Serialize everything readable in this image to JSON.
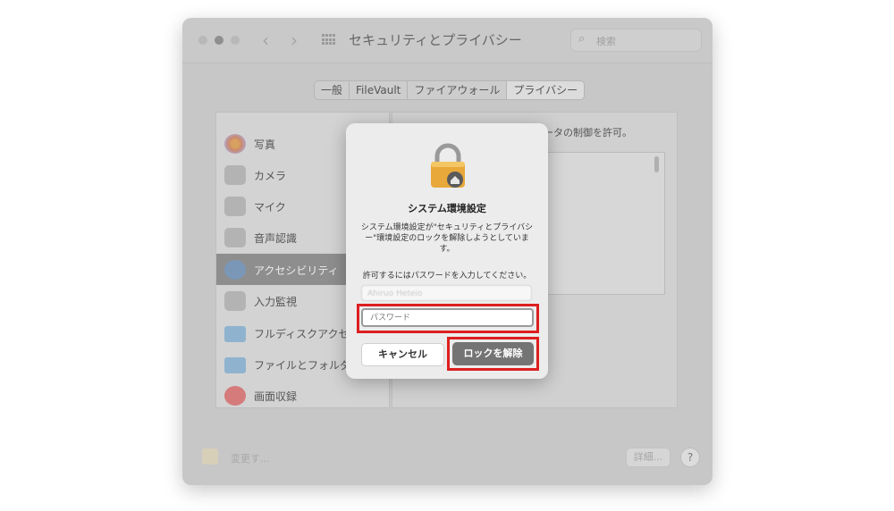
{
  "window": {
    "title": "セキュリティとプライバシー",
    "search_placeholder": "検索"
  },
  "tabs": [
    "一般",
    "FileVault",
    "ファイアウォール",
    "プライバシー"
  ],
  "active_tab": "プライバシー",
  "sidebar": {
    "items": [
      {
        "label": "写真",
        "icon": "photos-icon"
      },
      {
        "label": "カメラ",
        "icon": "camera-icon"
      },
      {
        "label": "マイク",
        "icon": "microphone-icon"
      },
      {
        "label": "音声認識",
        "icon": "speech-recognition-icon"
      },
      {
        "label": "アクセシビリティ",
        "icon": "accessibility-icon",
        "selected": true
      },
      {
        "label": "入力監視",
        "icon": "keyboard-icon"
      },
      {
        "label": "フルディスクアクセス",
        "icon": "folder-icon"
      },
      {
        "label": "ファイルとフォルダ",
        "icon": "folder-icon"
      },
      {
        "label": "画面収録",
        "icon": "screen-record-icon"
      }
    ]
  },
  "right_panel": {
    "text": "ータの制御を許可。"
  },
  "bottom_bar": {
    "lock_text": "変更す...",
    "advanced_label": "詳細...",
    "help_label": "?"
  },
  "dialog": {
    "title": "システム環境設定",
    "message": "システム環境設定が\"セキュリティとプライバシー\"環境設定のロックを解除しようとしています。",
    "prompt": "許可するにはパスワードを入力してください。",
    "username_value": "Ahiruo Heteio",
    "password_placeholder": "パスワード",
    "cancel_label": "キャンセル",
    "unlock_label": "ロックを解除"
  },
  "colors": {
    "highlight": "#dd1f1f",
    "unlock_button": "#747474",
    "lock_body": "#e8a93a"
  }
}
